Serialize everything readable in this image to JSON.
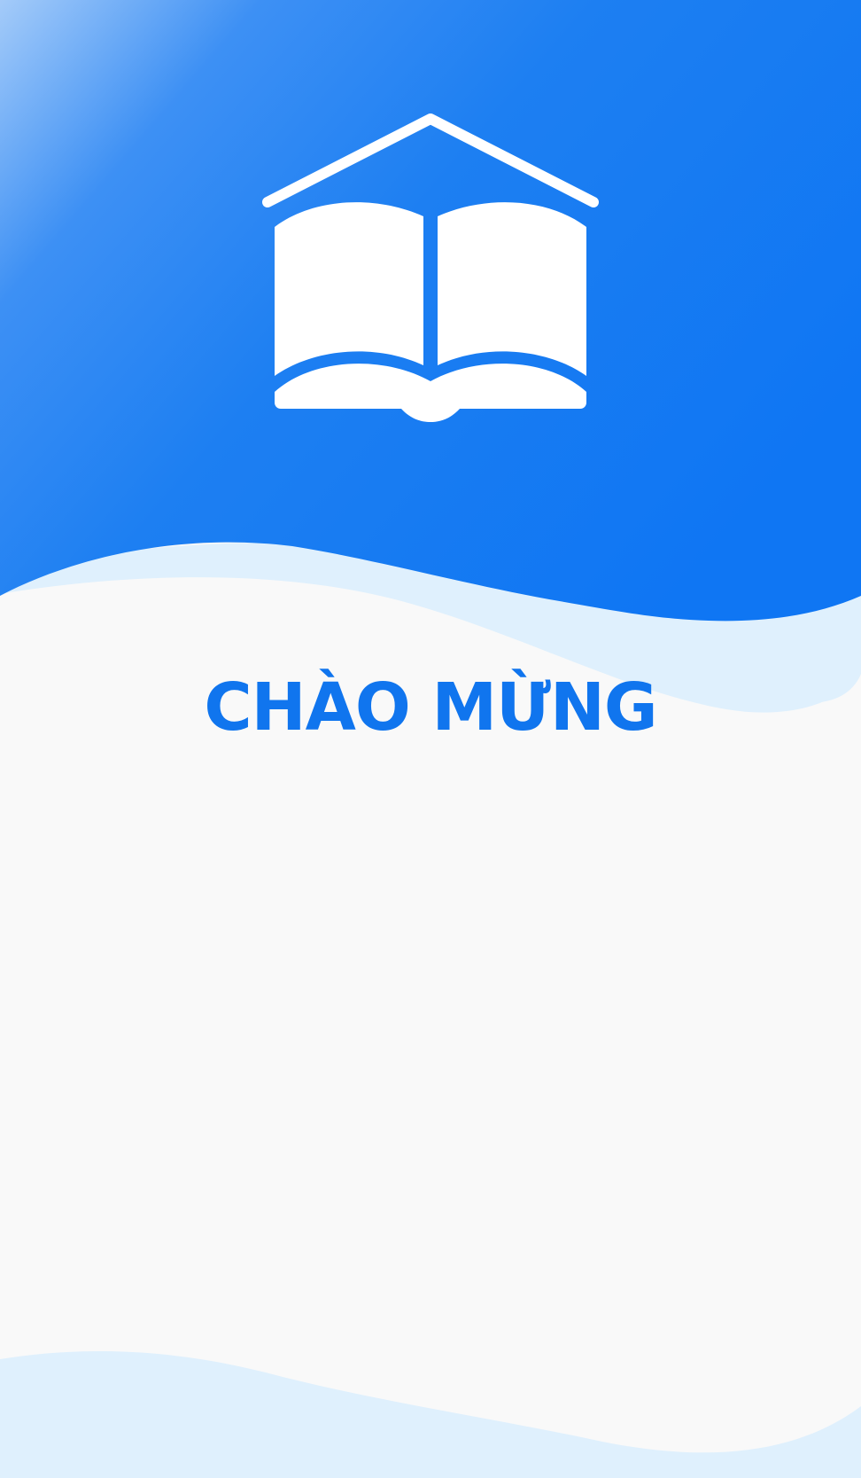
{
  "welcome": {
    "title": "CHÀO MỪNG"
  },
  "logo": {
    "icon": "open-book-house-icon"
  },
  "colors": {
    "primary_blue": "#1075ee",
    "gradient_light": "#a4cbf9",
    "wave_light_blue": "#dff0fd",
    "background": "#f9f9f9",
    "logo_white": "#ffffff"
  }
}
